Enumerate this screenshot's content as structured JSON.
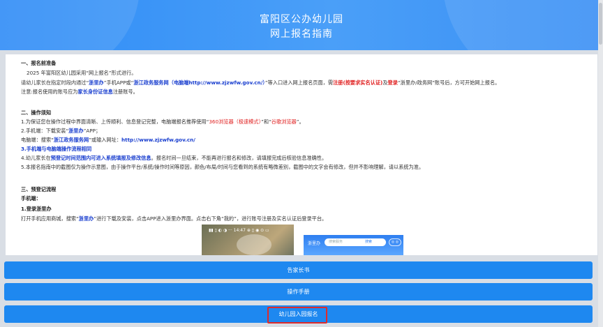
{
  "header": {
    "title_line1": "富阳区公办幼儿园",
    "title_line2": "网上报名指南"
  },
  "doc": {
    "s1_title": "一、报名前准备",
    "s1_l1": "2025 年富阳区幼儿园采用“网上报名”形式进行。",
    "s1_l2_a": "请幼儿家长在指定时段内通过“",
    "s1_l2_b": "浙里办",
    "s1_l2_c": "”手机APP或“",
    "s1_l2_d": "浙江政务服务网（电脑端http://www.zjzwfw.gov.cn/）",
    "s1_l2_e": "”等入口进入网上报名页面，需",
    "s1_l2_f": "注册(按要求实名认证)",
    "s1_l2_g": "及",
    "s1_l2_h": "登录",
    "s1_l2_i": "“浙里办/政务网”账号后，方可开始网上报名。",
    "s1_l3_a": "注意:报名使用的账号应为",
    "s1_l3_b": "家长身份证信息",
    "s1_l3_c": "注册账号。",
    "s2_title": "二、操作须知",
    "s2_l1_a": "1.为保证您在操作过程中界面清晰、上传顺利、信息登记完整，电脑端报名推荐使用“",
    "s2_l1_b": "360浏览器（极速模式）",
    "s2_l1_c": "”和“",
    "s2_l1_d": "谷歌浏览器",
    "s2_l1_e": "”。",
    "s2_l2_a": "2.手机端：下载安装“",
    "s2_l2_b": "浙里办",
    "s2_l2_c": "”APP；",
    "s2_l3_a": "电脑端：搜索“",
    "s2_l3_b": "浙江政务服务网",
    "s2_l3_c": "”或输入网址：",
    "s2_l3_d": "http://www.zjzwfw.gov.cn/",
    "s2_l4": "3.手机端与电脑端操作流程相同",
    "s2_l5_a": "4.幼儿家长在",
    "s2_l5_b": "预登记时间范围内可进入系统填报及修改信息",
    "s2_l5_c": "。报名时间一旦结束，不能再进行报名和修改，请填报完成后核验信息准确性。",
    "s2_l6": "5.本报名指南中的截图仅为操作示意图，由于操作平台/系统/操作时间等原因，颜色/布局/时间与您看到的系统有略微差别，截图中的文字会有修改，但并不影响理解，请以系统为准。",
    "s3_title": "三、预登记流程",
    "s3_sub": "手机端：",
    "s3_step": "1.登录浙里办",
    "s3_l1_a": "打开手机应用商城，搜索“",
    "s3_l1_b": "浙里办",
    "s3_l1_c": "”进行下载及安装，点击APP进入浙里办界面。点击右下角“我的”，进行账号注册及实名认证后登录平台。"
  },
  "screenshot": {
    "status": "▮▮ ▯ ◐ ◑ ···    14:47    ⊕ ▯ ◉ ⊙ ▭",
    "logo": "浙里办",
    "search_placeholder": "搜索服务",
    "search_btn": "搜索",
    "chip": "◎ ◎"
  },
  "buttons": {
    "b1": "告家长书",
    "b2": "操作手册",
    "b3": "幼儿园入园报名"
  }
}
